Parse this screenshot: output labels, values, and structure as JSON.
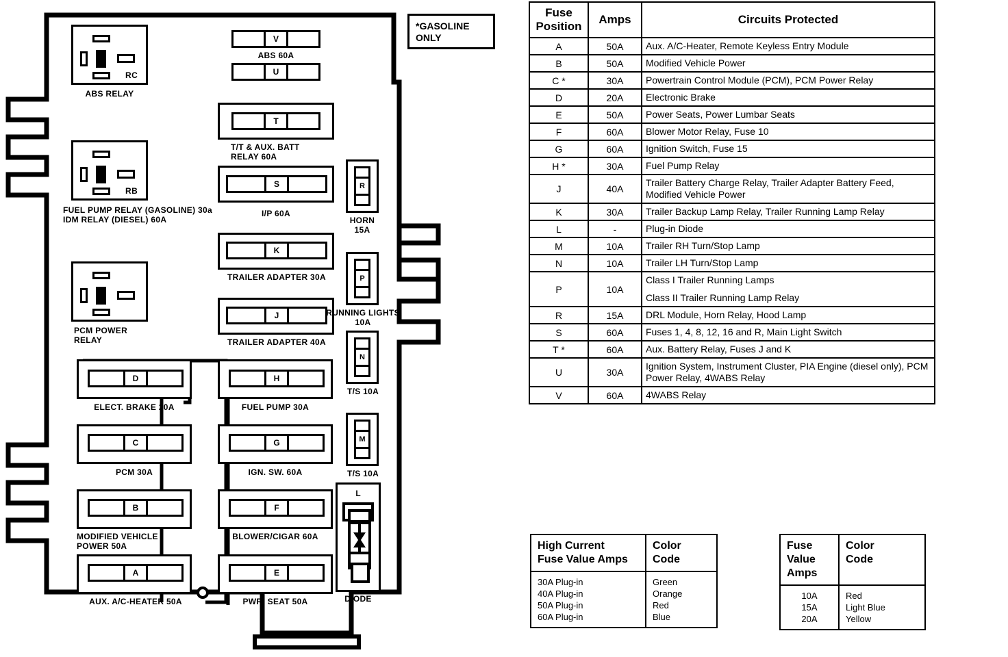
{
  "note": {
    "text": "*GASOLINE\nONLY"
  },
  "diagram": {
    "relays": [
      {
        "code": "RC",
        "label": "ABS RELAY"
      },
      {
        "code": "RB",
        "label": "FUEL PUMP RELAY (GASOLINE) 30a\nIDM RELAY (DIESEL) 60A"
      },
      {
        "code": "",
        "label": "PCM POWER\nRELAY"
      }
    ],
    "fuse_bars": [
      {
        "key": "V",
        "label": "ABS 60A"
      },
      {
        "key": "U",
        "label": ""
      },
      {
        "key": "T",
        "label": "T/T & AUX. BATT\nRELAY 60A"
      },
      {
        "key": "S",
        "label": "I/P 60A"
      },
      {
        "key": "K",
        "label": "TRAILER ADAPTER 30A"
      },
      {
        "key": "J",
        "label": "TRAILER ADAPTER 40A"
      },
      {
        "key": "D",
        "label": "ELECT. BRAKE 20A"
      },
      {
        "key": "H",
        "label": "FUEL PUMP 30A"
      },
      {
        "key": "C",
        "label": "PCM 30A"
      },
      {
        "key": "G",
        "label": "IGN. SW. 60A"
      },
      {
        "key": "B",
        "label": "MODIFIED VEHICLE\nPOWER 50A"
      },
      {
        "key": "F",
        "label": "BLOWER/CIGAR 60A"
      },
      {
        "key": "A",
        "label": "AUX. A/C-HEATER 50A"
      },
      {
        "key": "E",
        "label": "PWR. SEAT 50A"
      }
    ],
    "vertical_fuses": [
      {
        "key": "R",
        "label": "HORN\n15A"
      },
      {
        "key": "P",
        "label": "RUNNING LIGHTS\n10A"
      },
      {
        "key": "N",
        "label": "T/S 10A"
      },
      {
        "key": "M",
        "label": "T/S 10A"
      }
    ],
    "diode": {
      "key": "L",
      "label": "DIODE"
    }
  },
  "main_table": {
    "headers": [
      "Fuse\nPosition",
      "Amps",
      "Circuits Protected"
    ],
    "rows": [
      {
        "pos": "A",
        "amps": "50A",
        "desc": [
          "Aux.  A/C-Heater, Remote Keyless Entry Module"
        ]
      },
      {
        "pos": "B",
        "amps": "50A",
        "desc": [
          "Modified Vehicle Power"
        ]
      },
      {
        "pos": "C  *",
        "amps": "30A",
        "desc": [
          "Powertrain Control Module (PCM), PCM Power Relay"
        ]
      },
      {
        "pos": "D",
        "amps": "20A",
        "desc": [
          "Electronic Brake"
        ]
      },
      {
        "pos": "E",
        "amps": "50A",
        "desc": [
          "Power Seats, Power Lumbar Seats"
        ]
      },
      {
        "pos": "F",
        "amps": "60A",
        "desc": [
          "Blower Motor Relay, Fuse 10"
        ]
      },
      {
        "pos": "G",
        "amps": "60A",
        "desc": [
          "Ignition Switch, Fuse 15"
        ]
      },
      {
        "pos": "H  *",
        "amps": "30A",
        "desc": [
          "Fuel Pump Relay"
        ]
      },
      {
        "pos": "J",
        "amps": "40A",
        "desc": [
          "Trailer Battery Charge Relay, Trailer Adapter Battery Feed, Modified Vehicle Power"
        ]
      },
      {
        "pos": "K",
        "amps": "30A",
        "desc": [
          "Trailer Backup Lamp Relay, Trailer Running Lamp Relay"
        ]
      },
      {
        "pos": "L",
        "amps": "-",
        "desc": [
          "Plug-in Diode"
        ]
      },
      {
        "pos": "M",
        "amps": "10A",
        "desc": [
          "Trailer RH Turn/Stop Lamp"
        ]
      },
      {
        "pos": "N",
        "amps": "10A",
        "desc": [
          "Trailer LH Turn/Stop Lamp"
        ]
      },
      {
        "pos": "P",
        "amps": "10A",
        "desc": [
          "Class I Trailer Running  Lamps",
          "Class II Trailer Running  Lamp Relay"
        ]
      },
      {
        "pos": "R",
        "amps": "15A",
        "desc": [
          "DRL Module, Horn Relay, Hood Lamp"
        ]
      },
      {
        "pos": "S",
        "amps": "60A",
        "desc": [
          "Fuses 1, 4, 8, 12, 16 and R,  Main Light Switch"
        ]
      },
      {
        "pos": "T  *",
        "amps": "60A",
        "desc": [
          "Aux. Battery Relay,  Fuses J and K"
        ]
      },
      {
        "pos": "U",
        "amps": "30A",
        "desc": [
          "Ignition System, Instrument Cluster, PIA Engine (diesel only), PCM Power Relay, 4WABS Relay"
        ]
      },
      {
        "pos": "V",
        "amps": "60A",
        "desc": [
          "4WABS Relay"
        ]
      }
    ]
  },
  "legend_high_current": {
    "header_left": "High Current\nFuse Value Amps",
    "header_right": "Color\nCode",
    "values": "30A Plug-in\n40A Plug-in\n50A Plug-in\n60A Plug-in",
    "colors": "Green\nOrange\nRed\nBlue"
  },
  "legend_fuse_value": {
    "header_left": "Fuse\nValue\nAmps",
    "header_right": "Color\nCode",
    "values": "10A\n15A\n20A",
    "colors": "Red\nLight Blue\nYellow"
  }
}
